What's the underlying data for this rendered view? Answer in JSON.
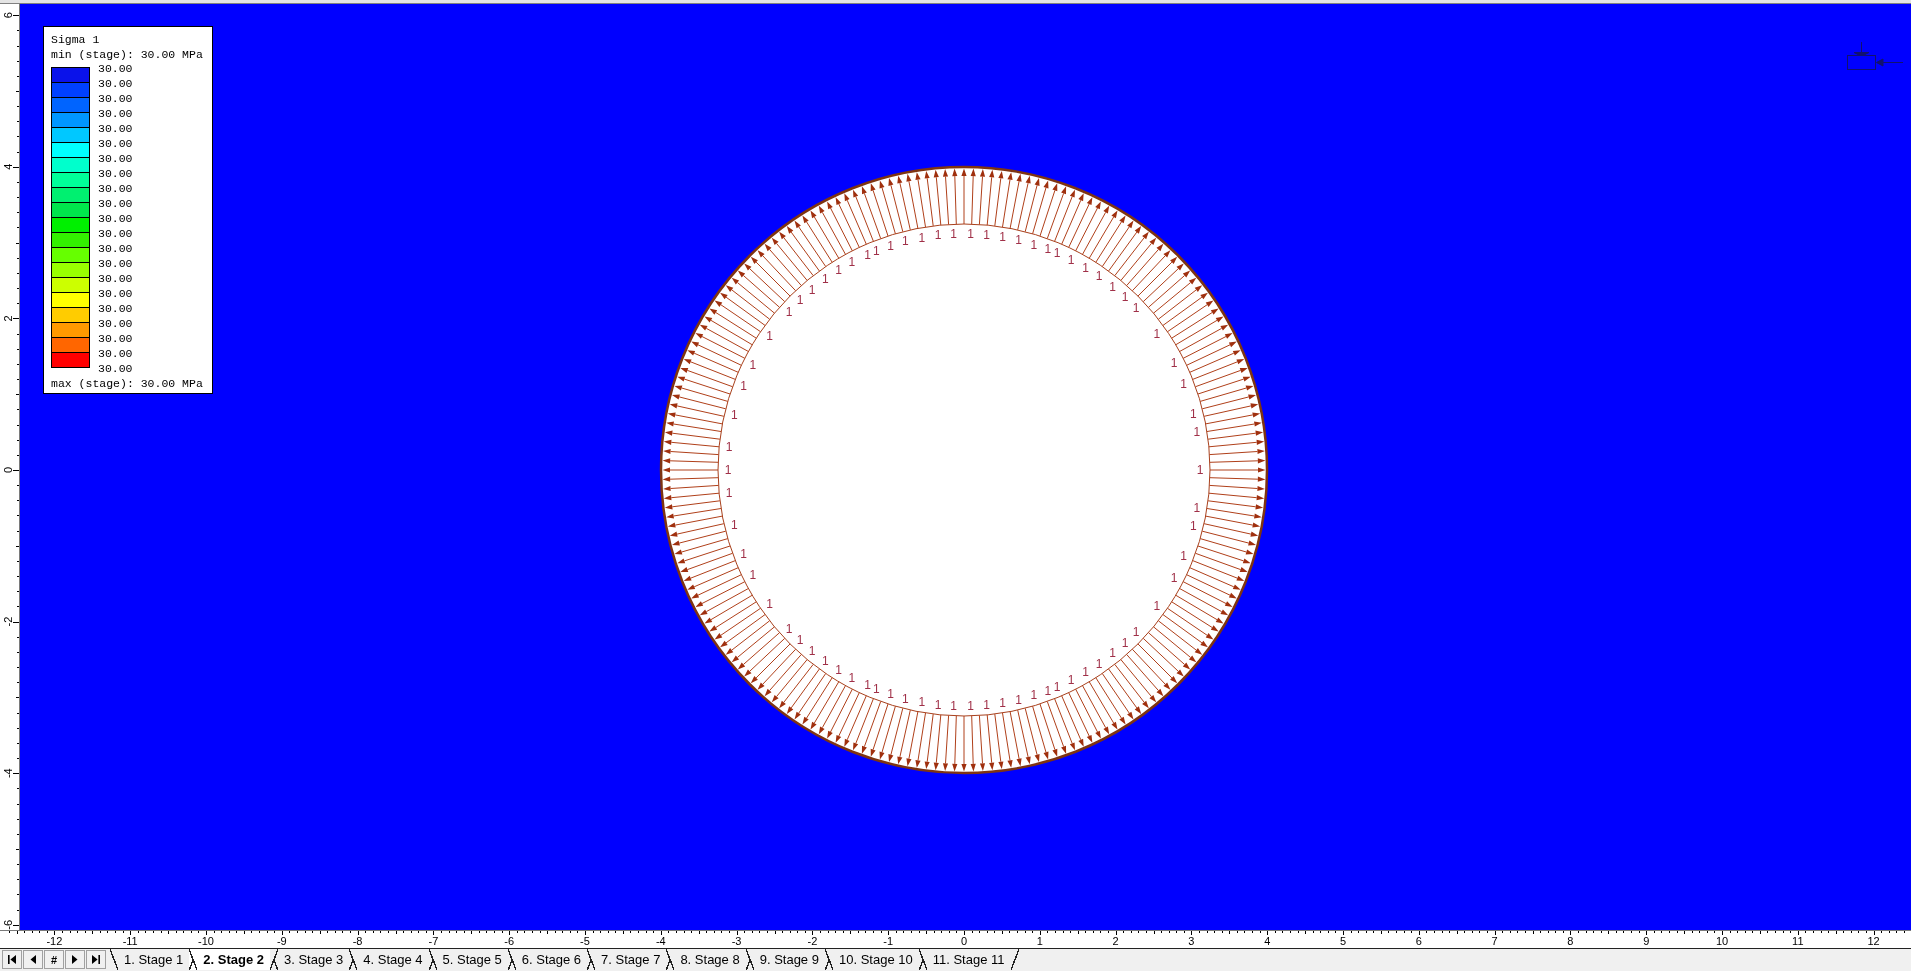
{
  "legend": {
    "title": "Sigma 1",
    "min_label": "min (stage): 30.00 MPa",
    "bins": [
      {
        "color": "#0a12ea"
      },
      {
        "color": "#0040ff"
      },
      {
        "color": "#0064ff"
      },
      {
        "color": "#0096ff"
      },
      {
        "color": "#00c8ff"
      },
      {
        "color": "#00ffff"
      },
      {
        "color": "#00ffcc"
      },
      {
        "color": "#00ff99"
      },
      {
        "color": "#00f070"
      },
      {
        "color": "#00e64c"
      },
      {
        "color": "#00f000"
      },
      {
        "color": "#33f000"
      },
      {
        "color": "#66ff00"
      },
      {
        "color": "#99ff00"
      },
      {
        "color": "#ccff00"
      },
      {
        "color": "#ffff00"
      },
      {
        "color": "#ffcc00"
      },
      {
        "color": "#ff9900"
      },
      {
        "color": "#ff6600"
      },
      {
        "color": "#ff0000"
      }
    ],
    "values": [
      "30.00",
      "30.00",
      "30.00",
      "30.00",
      "30.00",
      "30.00",
      "30.00",
      "30.00",
      "30.00",
      "30.00",
      "30.00",
      "30.00",
      "30.00",
      "30.00",
      "30.00",
      "30.00",
      "30.00",
      "30.00",
      "30.00",
      "30.00",
      "30.00"
    ],
    "max_label": "max (stage): 30.00 MPa"
  },
  "model": {
    "boundary_labels": [
      "1",
      "1",
      "1",
      "1",
      "1",
      "1",
      "1",
      "1",
      "1",
      "1",
      "1",
      "1",
      "1",
      "1",
      "1",
      "1",
      "1",
      "1",
      "1",
      "1",
      "1",
      "1",
      "1",
      "1",
      "1",
      "1",
      "1",
      "1",
      "1",
      "1",
      "1",
      "1",
      "1",
      "1",
      "1",
      "1",
      "1",
      "1",
      "1",
      "1",
      "1",
      "1",
      "1",
      "1",
      "1",
      "1",
      "1",
      "1",
      "1",
      "1",
      "1",
      "1",
      "1",
      "1",
      "1",
      "1",
      "1",
      "1",
      "1",
      "1",
      "1",
      "1",
      "1",
      "1",
      "1",
      "1",
      "1",
      "1",
      "1",
      "1",
      "1",
      "1",
      "1",
      "1"
    ]
  },
  "y_ruler": {
    "labels": [
      "6",
      "4",
      "2",
      "0",
      "-2",
      "-4",
      "-6"
    ]
  },
  "x_ruler": {
    "labels": [
      "-12",
      "-11",
      "-10",
      "-9",
      "-8",
      "-7",
      "-6",
      "-5",
      "-4",
      "-3",
      "-2",
      "-1",
      "0",
      "1",
      "2",
      "3",
      "4",
      "5",
      "6",
      "7",
      "8",
      "9",
      "10",
      "11",
      "12"
    ]
  },
  "stage_tabs": {
    "nav_buttons": [
      {
        "kind": "first"
      },
      {
        "kind": "previous"
      },
      {
        "kind": "text",
        "label": "#"
      },
      {
        "kind": "next"
      },
      {
        "kind": "last"
      }
    ],
    "tabs": [
      {
        "label": "1. Stage 1",
        "selected": false
      },
      {
        "label": "2. Stage 2",
        "selected": true
      },
      {
        "label": "3. Stage 3",
        "selected": false
      },
      {
        "label": "4. Stage 4",
        "selected": false
      },
      {
        "label": "5. Stage 5",
        "selected": false
      },
      {
        "label": "6. Stage 6",
        "selected": false
      },
      {
        "label": "7. Stage 7",
        "selected": false
      },
      {
        "label": "8. Stage 8",
        "selected": false
      },
      {
        "label": "9. Stage 9",
        "selected": false
      },
      {
        "label": "10. Stage 10",
        "selected": false
      },
      {
        "label": "11. Stage 11",
        "selected": false
      }
    ]
  }
}
